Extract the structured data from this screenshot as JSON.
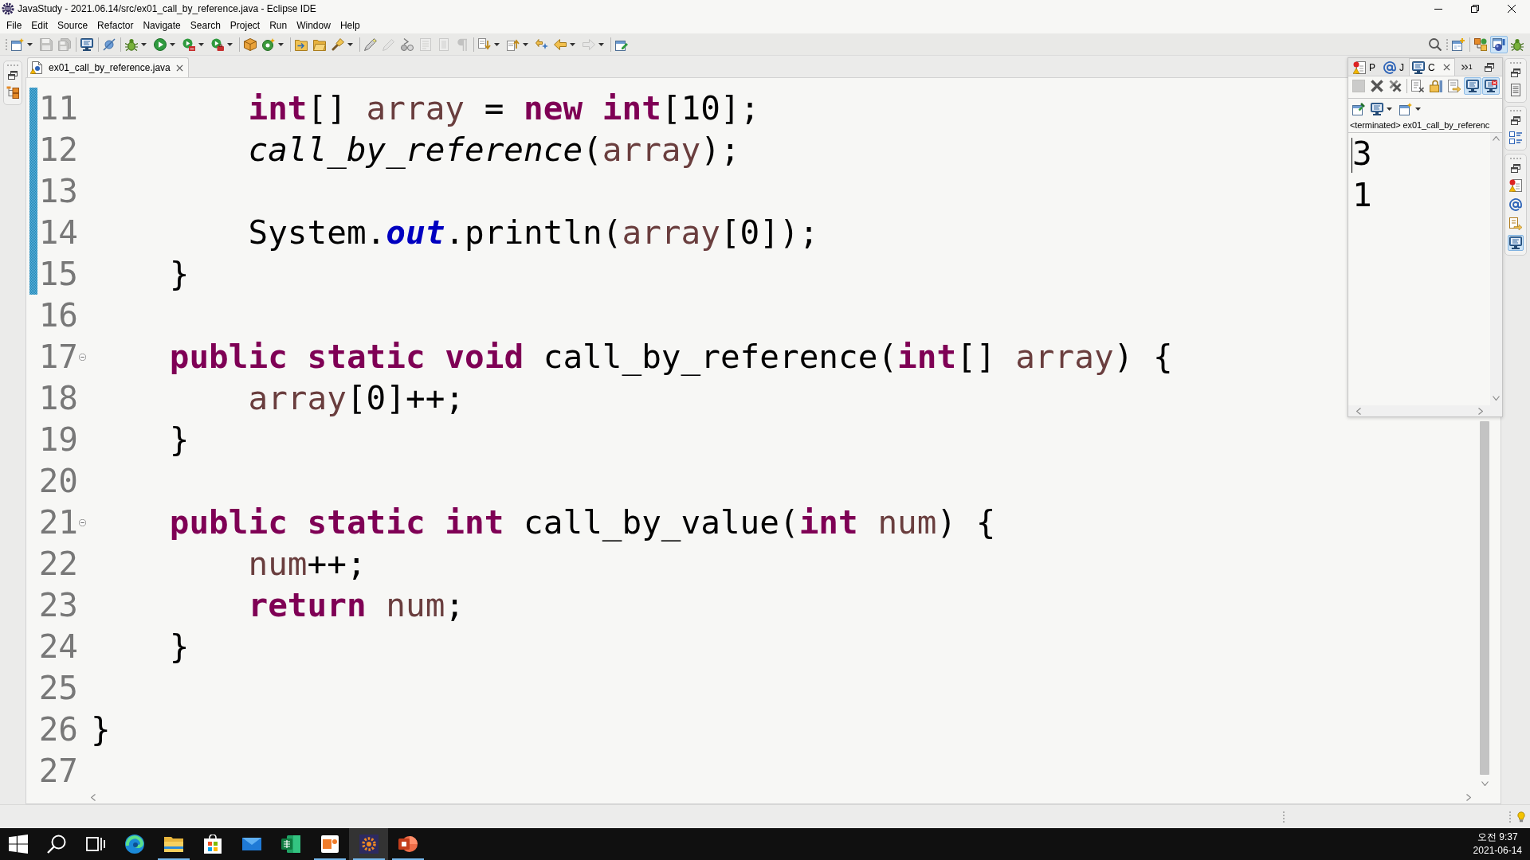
{
  "window": {
    "title": "JavaStudy - 2021.06.14/src/ex01_call_by_reference.java - Eclipse IDE"
  },
  "menu": [
    "File",
    "Edit",
    "Source",
    "Refactor",
    "Navigate",
    "Search",
    "Project",
    "Run",
    "Window",
    "Help"
  ],
  "toolbar": {
    "groups": [
      [
        {
          "kind": "new_wizard",
          "dropdown": true,
          "disabled": false
        },
        {
          "kind": "save",
          "dropdown": false,
          "disabled": true
        },
        {
          "kind": "save_all",
          "dropdown": false,
          "disabled": true
        }
      ],
      [
        {
          "kind": "terminal",
          "dropdown": false,
          "disabled": false
        }
      ],
      [
        {
          "kind": "skip_breakpoints",
          "dropdown": false,
          "disabled": false
        }
      ],
      [
        {
          "kind": "debug",
          "dropdown": true,
          "disabled": false
        },
        {
          "kind": "run",
          "dropdown": true,
          "disabled": false
        },
        {
          "kind": "coverage",
          "dropdown": true,
          "disabled": false
        },
        {
          "kind": "external_tools",
          "dropdown": true,
          "disabled": false
        }
      ],
      [
        {
          "kind": "new_package",
          "dropdown": false,
          "disabled": false
        },
        {
          "kind": "new_class",
          "dropdown": true,
          "disabled": false
        }
      ],
      [
        {
          "kind": "open_type",
          "dropdown": false,
          "disabled": false
        },
        {
          "kind": "open_folder",
          "dropdown": false,
          "disabled": false
        },
        {
          "kind": "search",
          "dropdown": true,
          "disabled": false
        }
      ],
      [
        {
          "kind": "mark_occurrences",
          "dropdown": false,
          "disabled": false
        },
        {
          "kind": "edit",
          "dropdown": false,
          "disabled": true
        },
        {
          "kind": "breadcrumb",
          "dropdown": false,
          "disabled": false
        },
        {
          "kind": "block_selection",
          "dropdown": false,
          "disabled": true
        },
        {
          "kind": "source_only",
          "dropdown": false,
          "disabled": true
        },
        {
          "kind": "whitespace",
          "dropdown": false,
          "disabled": true
        }
      ],
      [
        {
          "kind": "next_annotation",
          "dropdown": true,
          "disabled": false
        },
        {
          "kind": "prev_annotation",
          "dropdown": true,
          "disabled": false
        },
        {
          "kind": "last_edit",
          "dropdown": false,
          "disabled": false
        },
        {
          "kind": "back",
          "dropdown": true,
          "disabled": false
        },
        {
          "kind": "forward",
          "dropdown": true,
          "disabled": true
        }
      ],
      [
        {
          "kind": "pin_editor",
          "dropdown": false,
          "disabled": false
        }
      ]
    ],
    "perspectives": [
      {
        "kind": "resource",
        "selected": false
      },
      {
        "kind": "java",
        "selected": true
      },
      {
        "kind": "debug",
        "selected": false
      }
    ]
  },
  "trim_stacks": {
    "left": [
      {
        "views": [
          {
            "kind": "hierarchy",
            "selected": false
          }
        ]
      }
    ],
    "right": [
      {
        "views": [
          {
            "kind": "document",
            "selected": false
          }
        ]
      },
      {
        "views": [
          {
            "kind": "outline",
            "selected": false
          }
        ]
      },
      {
        "views": [
          {
            "kind": "problems",
            "selected": false
          },
          {
            "kind": "javadoc",
            "selected": false
          },
          {
            "kind": "declaration",
            "selected": false
          },
          {
            "kind": "console",
            "selected": true
          }
        ]
      }
    ]
  },
  "editor": {
    "tabs": [
      {
        "label": "ex01_call_by_reference.java",
        "selected": true
      }
    ],
    "lines": [
      {
        "children": [
          {
            "children": [
              {
                "number": "11",
                "in_range": true,
                "tokens": [
                  {
                    "text": "int",
                    "kind": "keyword"
                  },
                  {
                    "text": "[] ",
                    "kind": "plain"
                  },
                  {
                    "text": "array",
                    "kind": "variable"
                  },
                  {
                    "text": " = ",
                    "kind": "plain"
                  },
                  {
                    "text": "new",
                    "kind": "keyword"
                  },
                  {
                    "text": " int",
                    "kind": "keyword"
                  },
                  {
                    "text": "[10];",
                    "kind": "plain"
                  }
                ]
              },
              {
                "number": "12",
                "in_range": true,
                "tokens": [
                  {
                    "text": "call_by_reference",
                    "kind": "static_call"
                  },
                  {
                    "text": "(",
                    "kind": "plain"
                  },
                  {
                    "text": "array",
                    "kind": "variable"
                  },
                  {
                    "text": ");",
                    "kind": "plain"
                  }
                ]
              },
              {
                "number": "13",
                "in_range": true
              },
              {
                "number": "14",
                "in_range": true,
                "tokens": [
                  {
                    "text": "System.",
                    "kind": "plain"
                  },
                  {
                    "text": "out",
                    "kind": "static_field"
                  },
                  {
                    "text": ".println(",
                    "kind": "plain"
                  },
                  {
                    "text": "array",
                    "kind": "variable"
                  },
                  {
                    "text": "[0]);",
                    "kind": "plain"
                  }
                ]
              }
            ]
          },
          {
            "number": "15",
            "in_range": true,
            "tokens": [
              {
                "text": "}",
                "kind": "plain"
              }
            ]
          },
          {
            "number": "16",
            "in_range": false
          },
          {
            "number": "17",
            "in_range": false,
            "tokens": [
              {
                "text": "public",
                "kind": "keyword"
              },
              {
                "text": " static",
                "kind": "keyword"
              },
              {
                "text": " void",
                "kind": "keyword"
              },
              {
                "text": " call_by_reference(",
                "kind": "plain"
              },
              {
                "text": "int",
                "kind": "keyword"
              },
              {
                "text": "[] ",
                "kind": "plain"
              },
              {
                "text": "array",
                "kind": "variable"
              },
              {
                "text": ") {",
                "kind": "plain"
              }
            ],
            "children": [
              {
                "number": "18",
                "in_range": false,
                "tokens": [
                  {
                    "text": "array",
                    "kind": "variable"
                  },
                  {
                    "text": "[0]++;",
                    "kind": "plain"
                  }
                ]
              }
            ]
          },
          {
            "number": "19",
            "in_range": false,
            "tokens": [
              {
                "text": "}",
                "kind": "plain"
              }
            ]
          },
          {
            "number": "20",
            "in_range": false
          },
          {
            "number": "21",
            "in_range": false,
            "tokens": [
              {
                "text": "public",
                "kind": "keyword"
              },
              {
                "text": " static",
                "kind": "keyword"
              },
              {
                "text": " int",
                "kind": "keyword"
              },
              {
                "text": " call_by_value(",
                "kind": "plain"
              },
              {
                "text": "int",
                "kind": "keyword"
              },
              {
                "text": " num",
                "kind": "variable"
              },
              {
                "text": ") {",
                "kind": "plain"
              }
            ],
            "children": [
              {
                "number": "22",
                "in_range": false,
                "tokens": [
                  {
                    "text": "num",
                    "kind": "variable"
                  },
                  {
                    "text": "++;",
                    "kind": "plain"
                  }
                ]
              },
              {
                "number": "23",
                "in_range": false,
                "tokens": [
                  {
                    "text": "return",
                    "kind": "keyword"
                  },
                  {
                    "text": " num",
                    "kind": "variable"
                  },
                  {
                    "text": ";",
                    "kind": "plain"
                  }
                ]
              }
            ]
          },
          {
            "number": "24",
            "in_range": false,
            "tokens": [
              {
                "text": "}",
                "kind": "plain"
              }
            ]
          },
          {
            "number": "25",
            "in_range": false
          }
        ]
      },
      {
        "number": "26",
        "in_range": false,
        "tokens": [
          {
            "text": "}",
            "kind": "plain"
          }
        ]
      },
      {
        "number": "27",
        "in_range": false
      }
    ]
  },
  "console_view": {
    "tabs": [
      {
        "kind": "problems",
        "label": "P",
        "selected": false
      },
      {
        "kind": "javadoc",
        "label": "J",
        "selected": false
      },
      {
        "kind": "console",
        "label": "C",
        "selected": true
      }
    ],
    "overflow_count": "1",
    "toolbar_rows": [
      {
        "groups": [
          [
            {
              "kind": "terminate",
              "dropdown": false,
              "disabled": true,
              "pressed": false
            },
            {
              "kind": "remove_launch",
              "dropdown": false,
              "disabled": false,
              "pressed": false
            },
            {
              "kind": "remove_all",
              "dropdown": false,
              "disabled": false,
              "pressed": false
            }
          ],
          [
            {
              "kind": "clear",
              "dropdown": false,
              "disabled": false,
              "pressed": false
            },
            {
              "kind": "scroll_lock",
              "dropdown": false,
              "disabled": false,
              "pressed": false
            },
            {
              "kind": "word_wrap",
              "dropdown": false,
              "disabled": false,
              "pressed": false
            },
            {
              "kind": "show_stdout",
              "dropdown": false,
              "disabled": false,
              "pressed": true
            },
            {
              "kind": "show_stderr",
              "dropdown": false,
              "disabled": false,
              "pressed": true
            }
          ]
        ]
      },
      {
        "groups": [
          [
            {
              "kind": "pin",
              "dropdown": false,
              "disabled": false,
              "pressed": false
            },
            {
              "kind": "display_console",
              "dropdown": true,
              "disabled": false,
              "pressed": false
            },
            {
              "kind": "open_console",
              "dropdown": true,
              "disabled": false,
              "pressed": false
            }
          ]
        ]
      }
    ],
    "process": "<terminated> ex01_call_by_referenc",
    "output": [
      {
        "text": "3",
        "caret": true
      },
      {
        "text": "1",
        "caret": false
      }
    ]
  },
  "taskbar": {
    "apps": [
      {
        "kind": "browser",
        "running": false,
        "active": false
      },
      {
        "kind": "files",
        "running": true,
        "active": false
      },
      {
        "kind": "store",
        "running": false,
        "active": false
      },
      {
        "kind": "mail",
        "running": false,
        "active": false
      },
      {
        "kind": "spreadsheet",
        "running": false,
        "active": false
      },
      {
        "kind": "app",
        "running": true,
        "active": false
      },
      {
        "kind": "ide",
        "running": true,
        "active": true
      },
      {
        "kind": "slides",
        "running": true,
        "active": false
      }
    ],
    "clock": {
      "time": "오전 9:37",
      "date": "2021-06-14"
    }
  }
}
